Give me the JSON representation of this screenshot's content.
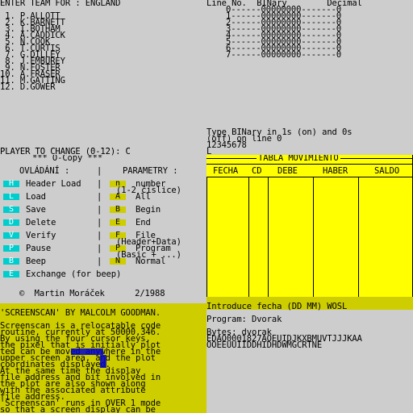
{
  "team": {
    "heading": "ENTER TEAM FOR : ENGLAND",
    "players": [
      " 1. P.ALLOTT",
      " 2. K.BARNETT",
      " 3. I.BOTHAM",
      " 4. A.CADDICK",
      " 5. N.COOK",
      " 6. T.CURTIS",
      " 7. G.DILLEY",
      " 8. J.EMBUREY",
      " 9. N.FOSTER",
      "10. A.FRASER",
      "11. M.GATTING",
      "12. D.GOWER"
    ],
    "prompt": "PLAYER TO CHANGE (0-12): C"
  },
  "binary": {
    "header": "Line No.  BINary        Decimal",
    "rows": [
      "0------00000000-------0",
      "1------00000000-------0",
      "2------00000000-------0",
      "3------00000000-------0",
      "4------00000000-------0",
      "5------00000000-------0",
      "6------00000000-------0",
      "7------00000000-------0"
    ],
    "instr1": "Type BINary in 1s (on) and 0s",
    "instr2": "(off) on line 0",
    "digits": "12345678",
    "cursor": "L"
  },
  "copy": {
    "title": "*** O-Copy ***",
    "col1_header": "OVLÁDÁNÍ :",
    "col2_header": "PARAMETRY :",
    "rows": [
      {
        "key": "H",
        "label": "Header Load",
        "pkey": "n",
        "param": "number"
      },
      {
        "key": "L",
        "label": "Load",
        "pkey": "A",
        "param": "All"
      },
      {
        "key": "S",
        "label": "Save",
        "pkey": "B",
        "param": "Begin"
      },
      {
        "key": "D",
        "label": "Delete",
        "pkey": "E",
        "param": "End"
      },
      {
        "key": "V",
        "label": "Verify",
        "pkey": "F",
        "param": "File"
      },
      {
        "key": "P",
        "label": "Pause",
        "pkey": "P",
        "param": "Program"
      },
      {
        "key": "B",
        "label": "Beep",
        "pkey": "N",
        "param": "Normal"
      },
      {
        "key": "E",
        "label": "Exchange (for beep)",
        "pkey": "",
        "param": ""
      }
    ],
    "sub_number": "(1-2 číslice)",
    "sub_file": "(Header+Data)",
    "sub_program": "(Basic + ...)",
    "credit": "©  Martin Moráček      2/1988"
  },
  "tabla": {
    "title": "TABLA MOVIMIENTO",
    "columns": [
      "FECHA",
      "CD",
      "DEBE",
      "HABER",
      "SALDO"
    ],
    "prompt": "Introduce fecha (DD MM) WOSL"
  },
  "screenscan": {
    "title": "'SCREENSCAN' BY MALCOLM GOODMAN.",
    "lines": [
      "Screenscan is a relocatable code",
      "routine, currently at 50000,346.",
      "By using the four cursor keys,",
      "the pixel that is initially plot",
      "ted can be moved anywhere in the",
      "upper screen area, and the plot",
      "coordinates displayed.",
      "At the same time the display",
      "file address and bit involved in",
      "the plot are also shown along",
      "with the associated attribute",
      "file address.",
      "'Screenscan' runs in OVER 1 mode",
      "so that a screen display can be"
    ]
  },
  "dvorak": {
    "program": "Program: Dvorak",
    "bytes": "Bytes: dvorak",
    "line1": "EDAO0001827AOEUIDJKXBMUVTJJJKAA",
    "line2": "OOEEUUIIDDHIDHDWMGCRTNE"
  },
  "colors": {
    "cyan": "#00cdcd",
    "yellow": "#cdcd00",
    "grey": "#cdcdcd",
    "blue": "#0000cd",
    "paper_yellow": "#ffff00"
  }
}
